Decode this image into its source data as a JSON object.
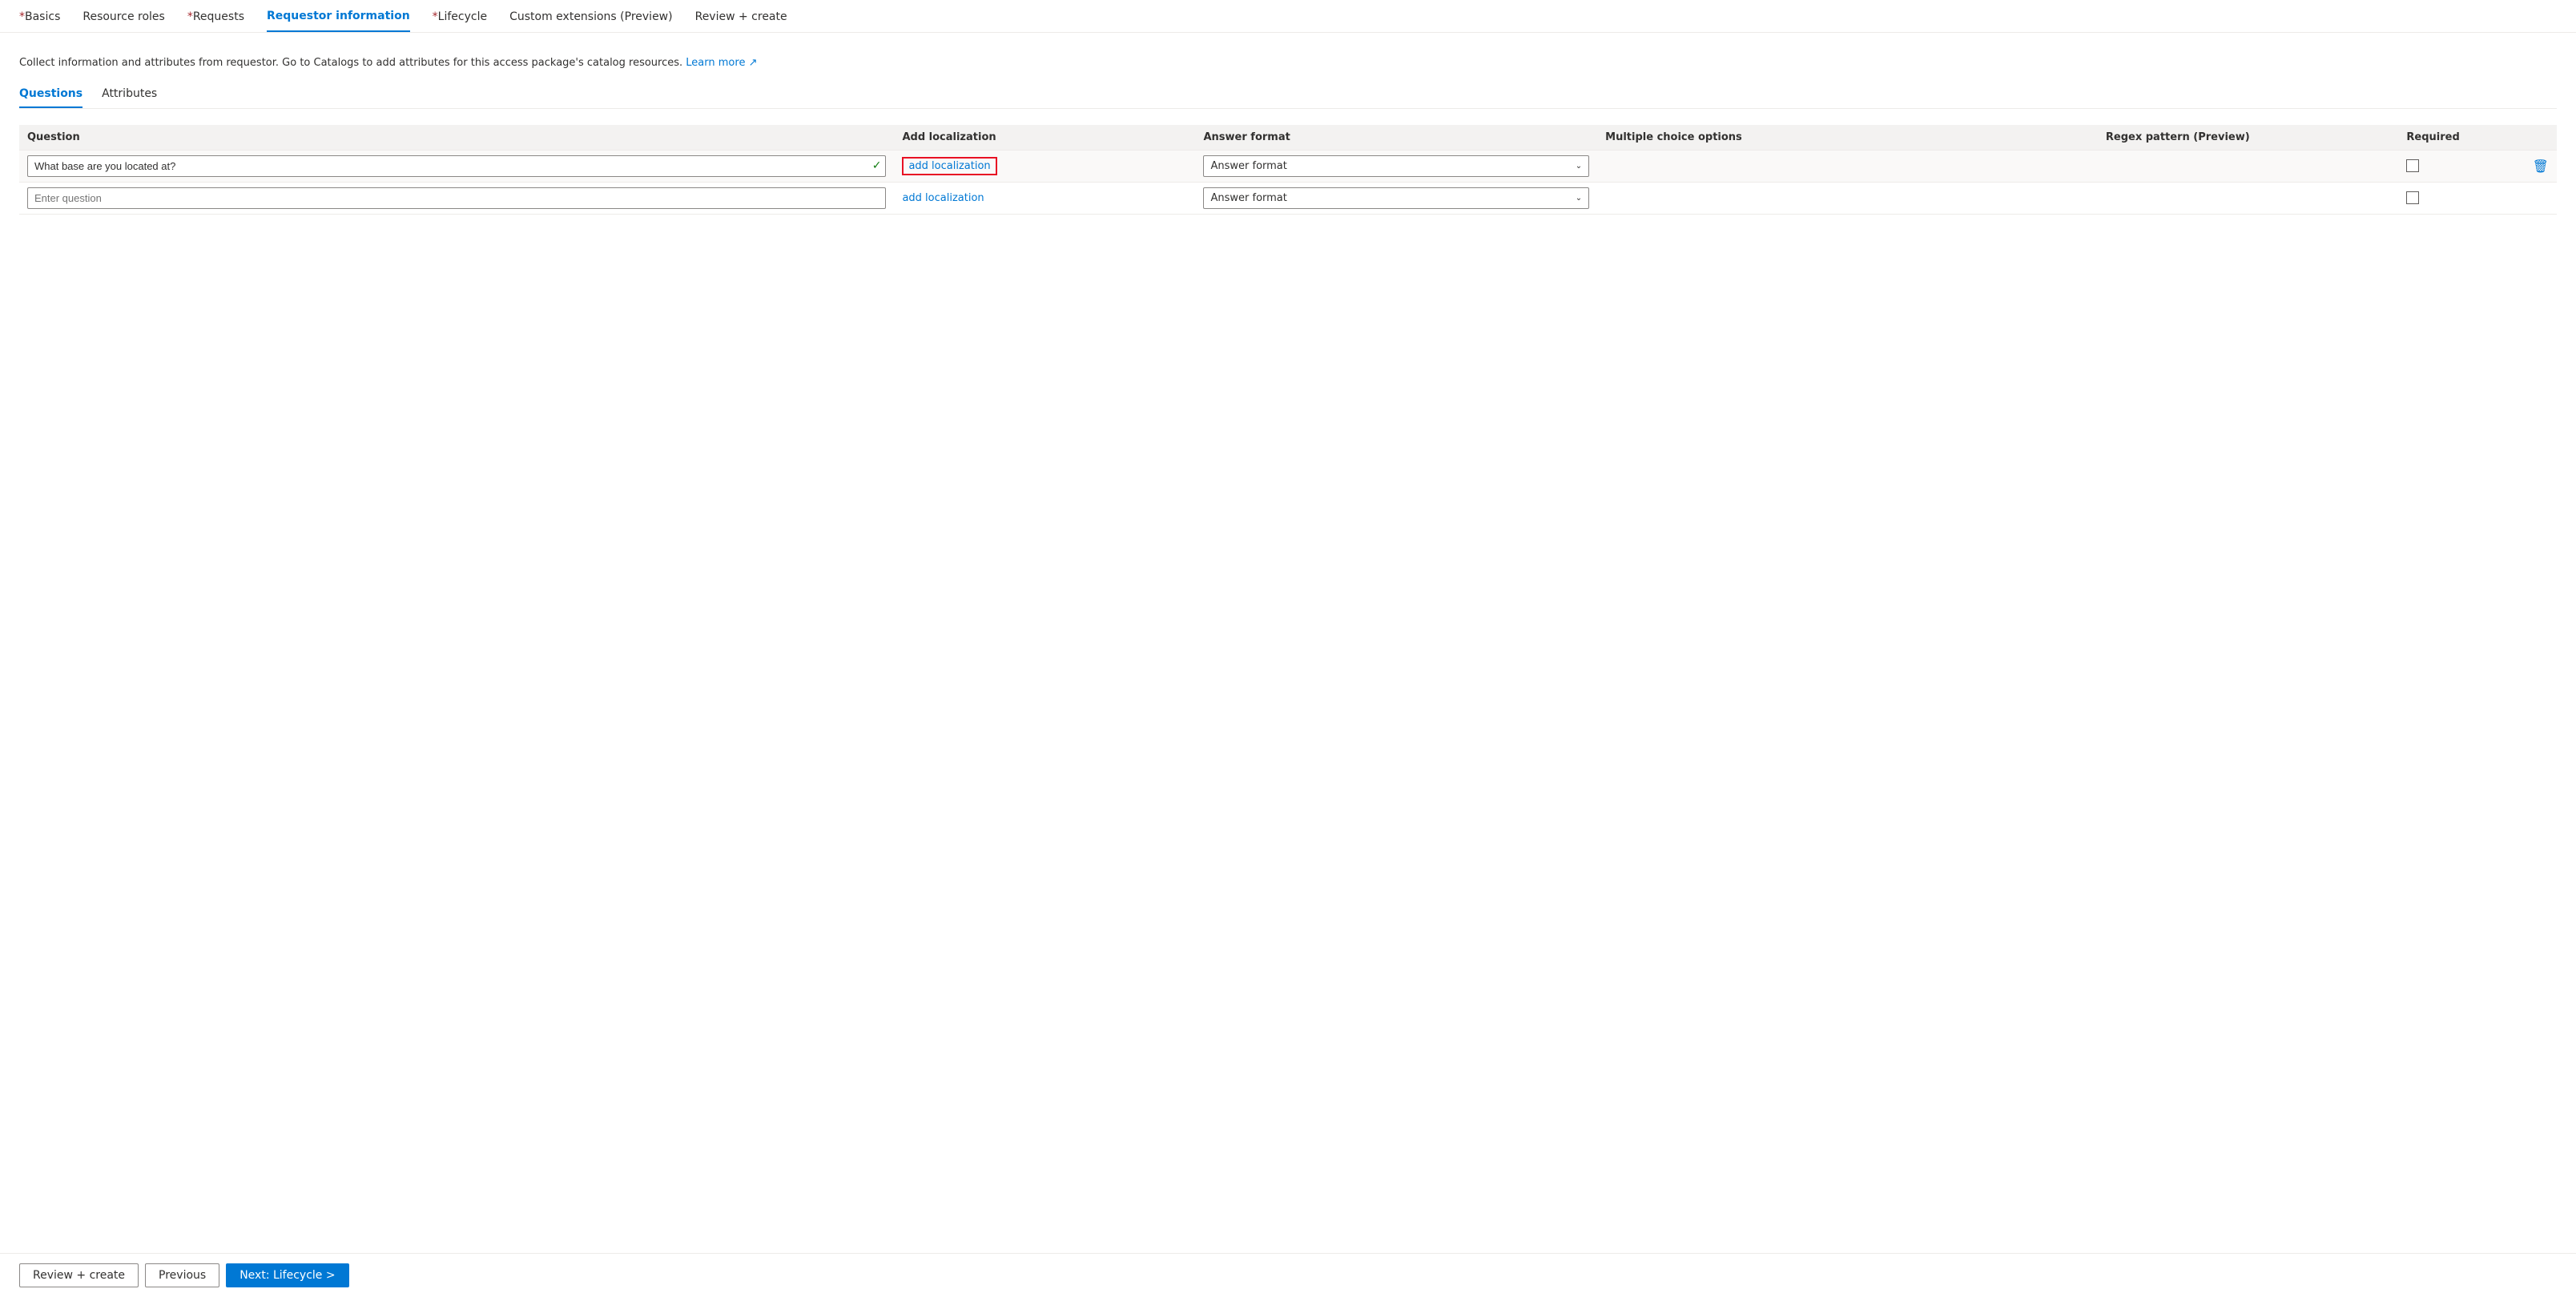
{
  "nav": {
    "tabs": [
      {
        "id": "basics",
        "label": "Basics",
        "required": true,
        "active": false
      },
      {
        "id": "resource-roles",
        "label": "Resource roles",
        "required": false,
        "active": false
      },
      {
        "id": "requests",
        "label": "Requests",
        "required": true,
        "active": false
      },
      {
        "id": "requestor-information",
        "label": "Requestor information",
        "required": false,
        "active": true
      },
      {
        "id": "lifecycle",
        "label": "Lifecycle",
        "required": true,
        "active": false
      },
      {
        "id": "custom-extensions",
        "label": "Custom extensions (Preview)",
        "required": false,
        "active": false
      },
      {
        "id": "review-create",
        "label": "Review + create",
        "required": false,
        "active": false
      }
    ]
  },
  "description": {
    "text": "Collect information and attributes from requestor. Go to Catalogs to add attributes for this access package's catalog resources.",
    "link_text": "Learn more",
    "link_icon": "↗"
  },
  "sub_tabs": [
    {
      "id": "questions",
      "label": "Questions",
      "active": true
    },
    {
      "id": "attributes",
      "label": "Attributes",
      "active": false
    }
  ],
  "table": {
    "columns": [
      {
        "id": "question",
        "label": "Question"
      },
      {
        "id": "add-localization",
        "label": "Add localization"
      },
      {
        "id": "answer-format",
        "label": "Answer format"
      },
      {
        "id": "multiple-choice",
        "label": "Multiple choice options"
      },
      {
        "id": "regex",
        "label": "Regex pattern (Preview)"
      },
      {
        "id": "required",
        "label": "Required"
      }
    ],
    "rows": [
      {
        "id": "row-1",
        "question_value": "What base are you located at?",
        "question_placeholder": "",
        "has_value": true,
        "localization_label": "add localization",
        "localization_highlighted": true,
        "answer_format": "Answer format",
        "multiple_choice": "",
        "regex": "",
        "required": false,
        "show_delete": true
      },
      {
        "id": "row-2",
        "question_value": "",
        "question_placeholder": "Enter question",
        "has_value": false,
        "localization_label": "add localization",
        "localization_highlighted": false,
        "answer_format": "Answer format",
        "multiple_choice": "",
        "regex": "",
        "required": false,
        "show_delete": false
      }
    ]
  },
  "footer": {
    "review_create_label": "Review + create",
    "previous_label": "Previous",
    "next_label": "Next: Lifecycle >"
  }
}
